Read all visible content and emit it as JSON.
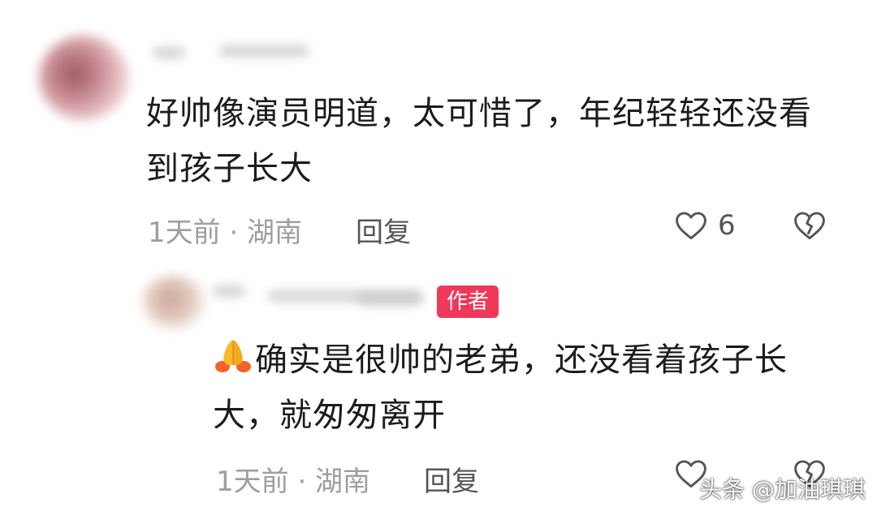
{
  "comments": [
    {
      "text": "好帅像演员明道，太可惜了，年纪轻轻还没看到孩子长大",
      "meta": "1天前 · 湖南",
      "reply_label": "回复",
      "like_count": "6"
    },
    {
      "badge": "作者",
      "text": "确实是很帅的老弟，还没看着孩子长大，就匆匆离开",
      "meta": "1天前 · 湖南",
      "reply_label": "回复"
    }
  ],
  "watermark": "头条 @加油琪琪",
  "colors": {
    "badge_bg": "#f0385a",
    "text": "#1c1c1c",
    "meta": "#9e9e9e",
    "icon": "#555555"
  },
  "icons": [
    "heart-outline-icon",
    "broken-heart-icon",
    "folded-hands-emoji"
  ]
}
